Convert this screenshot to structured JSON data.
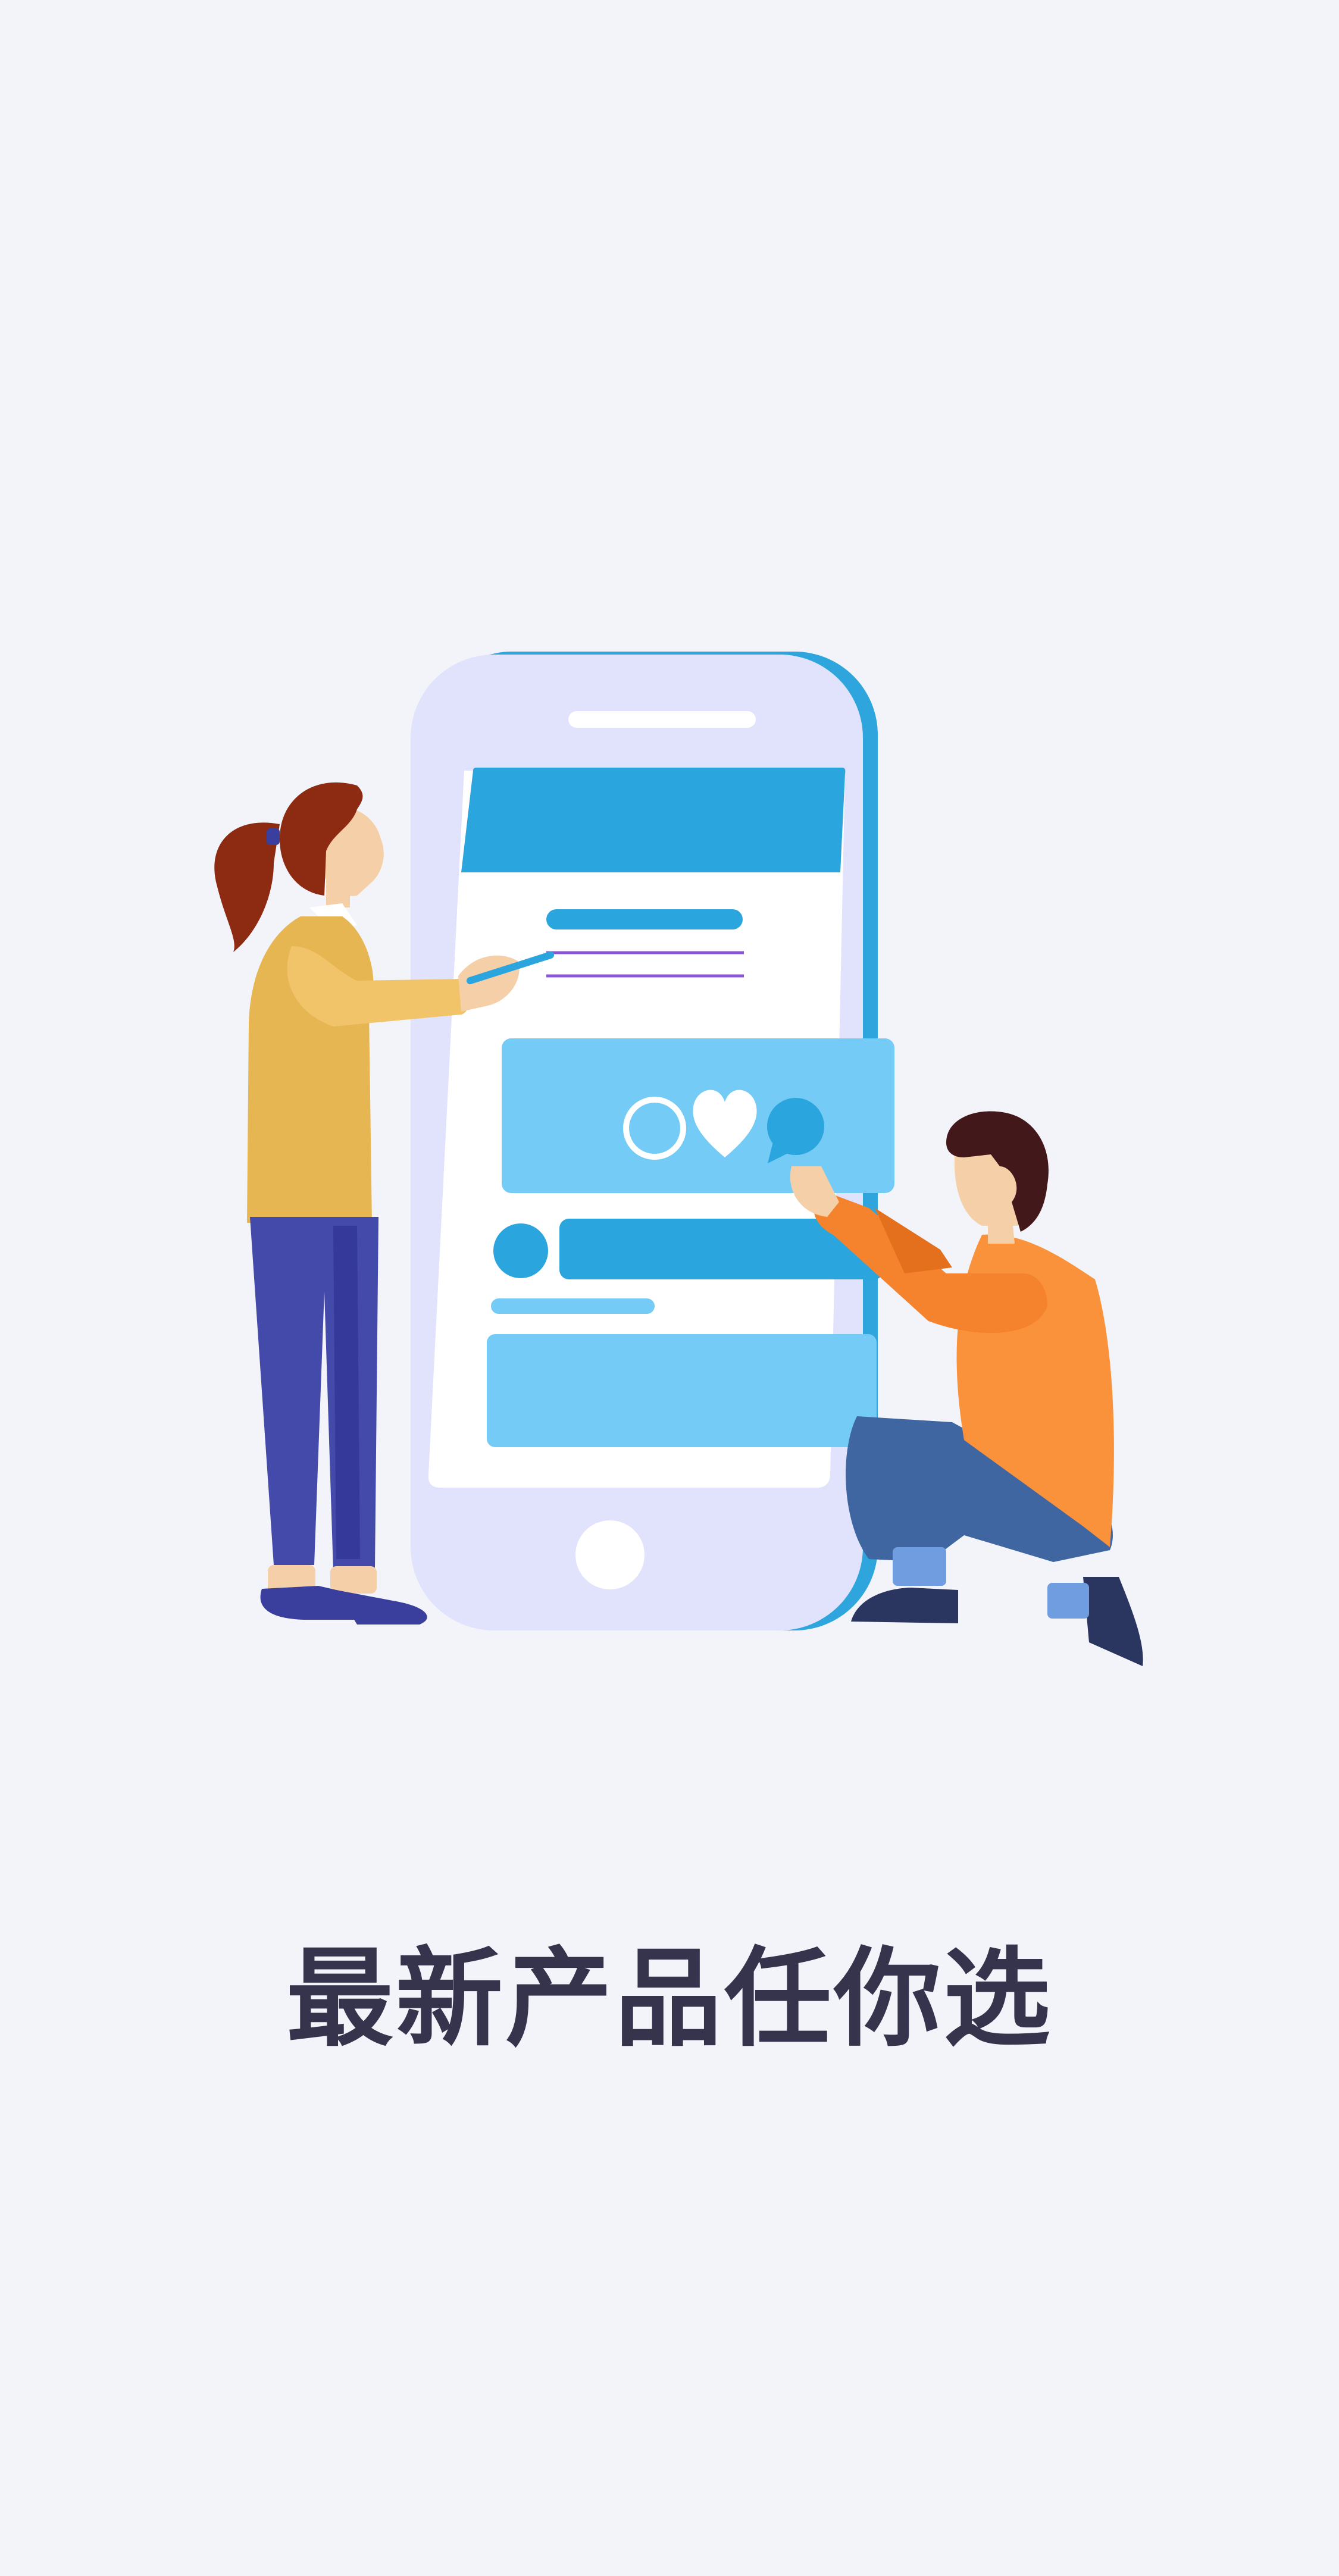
{
  "onboarding": {
    "slogan": "最新产品任你选",
    "illustration_icons": [
      "ring-icon",
      "heart-icon",
      "chat-bubble-icon"
    ]
  },
  "colors": {
    "background": "#f3f4fa",
    "slogan_text": "#35344c",
    "phone_body": "#e0e3fb",
    "phone_edge": "#2ea5dd",
    "primary_blue": "#2ba5de",
    "light_blue": "#74cbf5",
    "woman_sweater": "#e6b653",
    "woman_pants": "#434aaa",
    "man_shirt": "#fa923c",
    "man_pants": "#3f66a0",
    "hair": "#8c2a12"
  }
}
